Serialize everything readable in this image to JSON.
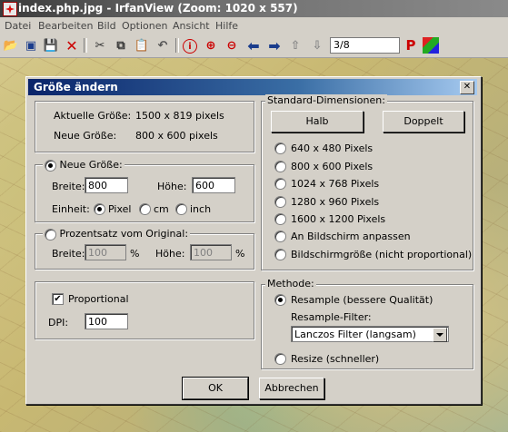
{
  "window": {
    "title": "index.php.jpg - IrfanView (Zoom: 1020 x 557)"
  },
  "menu": [
    "Datei",
    "Bearbeiten",
    "Bild",
    "Optionen",
    "Ansicht",
    "Hilfe"
  ],
  "toolbar": {
    "page_value": "3/8",
    "icons": [
      "open-folder-icon",
      "slideshow-icon",
      "save-icon",
      "delete-icon",
      "cut-icon",
      "copy-icon",
      "paste-icon",
      "undo-icon",
      "info-icon",
      "zoom-in-icon",
      "zoom-out-icon",
      "previous-icon",
      "next-icon",
      "first-page-icon",
      "last-page-icon",
      "print-icon",
      "plugin-icon"
    ]
  },
  "dialog": {
    "title": "Größe ändern",
    "current_size_label": "Aktuelle Größe:",
    "current_size_value": "1500  x  819  pixels",
    "new_size_label": "Neue Größe:",
    "new_size_value": "800  x  600  pixels",
    "new_size_group": {
      "radio_label": "Neue Größe:",
      "width_label": "Breite:",
      "width_value": "800",
      "height_label": "Höhe:",
      "height_value": "600",
      "unit_label": "Einheit:",
      "unit_pixel": "Pixel",
      "unit_cm": "cm",
      "unit_inch": "inch"
    },
    "percent_group": {
      "radio_label": "Prozentsatz vom Original:",
      "width_label": "Breite:",
      "width_value": "100",
      "height_label": "Höhe:",
      "height_value": "100",
      "percent_symbol": "%"
    },
    "proportional_label": "Proportional",
    "dpi_label": "DPI:",
    "dpi_value": "100",
    "standard": {
      "group_label": "Standard-Dimensionen:",
      "half_button": "Halb",
      "double_button": "Doppelt",
      "options": [
        "640 x 480 Pixels",
        "800 x 600 Pixels",
        "1024 x 768 Pixels",
        "1280 x 960 Pixels",
        "1600 x 1200 Pixels",
        "An Bildschirm anpassen",
        "Bildschirmgröße (nicht proportional)"
      ]
    },
    "method": {
      "group_label": "Methode:",
      "resample_label": "Resample (bessere Qualität)",
      "filter_label": "Resample-Filter:",
      "filter_value": "Lanczos Filter (langsam)",
      "resize_label": "Resize (schneller)"
    },
    "ok_button": "OK",
    "cancel_button": "Abbrechen"
  }
}
